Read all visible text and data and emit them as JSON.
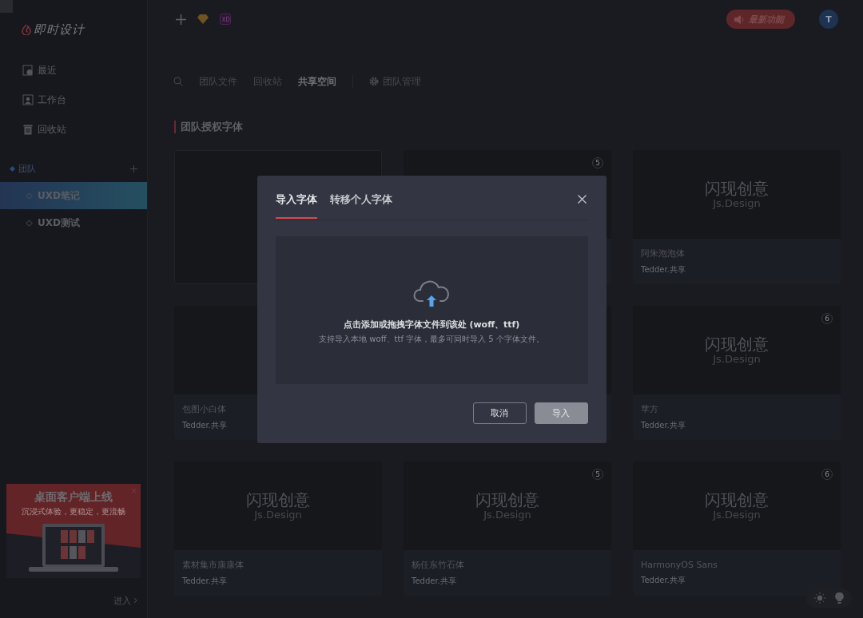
{
  "sidebar": {
    "logo": "即时设计",
    "nav": [
      {
        "label": "最近",
        "selected": false
      },
      {
        "label": "工作台",
        "selected": false
      },
      {
        "label": "回收站",
        "selected": false
      }
    ],
    "team_header": "团队",
    "teams": [
      {
        "label": "UXD笔记",
        "selected": true
      },
      {
        "label": "UXD测试",
        "selected": false
      }
    ],
    "promo": {
      "title": "桌面客户端上线",
      "subtitle": "沉浸式体验，更稳定，更流畅"
    },
    "footer_link": "进入"
  },
  "topbar": {
    "news_button": "最新功能",
    "avatar": "T"
  },
  "tabs": [
    {
      "label": "团队文件",
      "selected": false
    },
    {
      "label": "回收站",
      "selected": false
    },
    {
      "label": "共享空间",
      "selected": true
    }
  ],
  "manage": "团队管理",
  "section_title": "团队授权字体",
  "cards": [
    {
      "kind": "empty"
    },
    {
      "kind": "font",
      "badge": "5"
    },
    {
      "kind": "font",
      "preview_title": "闪现创意",
      "preview_subtitle": "Js.Design",
      "name": "阿朱泡泡体",
      "owner": "Tedder.共享"
    },
    {
      "kind": "font",
      "name": "包图小白体",
      "owner": "Tedder.共享"
    },
    {
      "kind": "font"
    },
    {
      "kind": "font",
      "badge": "6",
      "preview_title": "闪现创意",
      "preview_subtitle": "Js.Design",
      "name": "苹方",
      "owner": "Tedder.共享"
    },
    {
      "kind": "font",
      "preview_title": "闪现创意",
      "preview_subtitle": "Js.Design",
      "name": "素材集市康康体",
      "owner": "Tedder.共享"
    },
    {
      "kind": "font",
      "badge": "5",
      "preview_title": "闪现创意",
      "preview_subtitle": "Js.Design",
      "name": "杨任东竹石体",
      "owner": "Tedder.共享"
    },
    {
      "kind": "font",
      "badge": "6",
      "preview_title": "闪现创意",
      "preview_subtitle": "Js.Design",
      "name": "HarmonyOS Sans",
      "owner": "Tedder.共享"
    }
  ],
  "dialog": {
    "tabs": [
      {
        "label": "导入字体",
        "selected": true
      },
      {
        "label": "转移个人字体",
        "selected": false
      }
    ],
    "drop_title": "点击添加或拖拽字体文件到该处 (woff、ttf)",
    "drop_hint": "支持导入本地 woff、ttf 字体，最多可同时导入 5 个字体文件。",
    "buttons": [
      {
        "label": "取消",
        "kind": "secondary"
      },
      {
        "label": "导入",
        "kind": "primary"
      }
    ]
  }
}
